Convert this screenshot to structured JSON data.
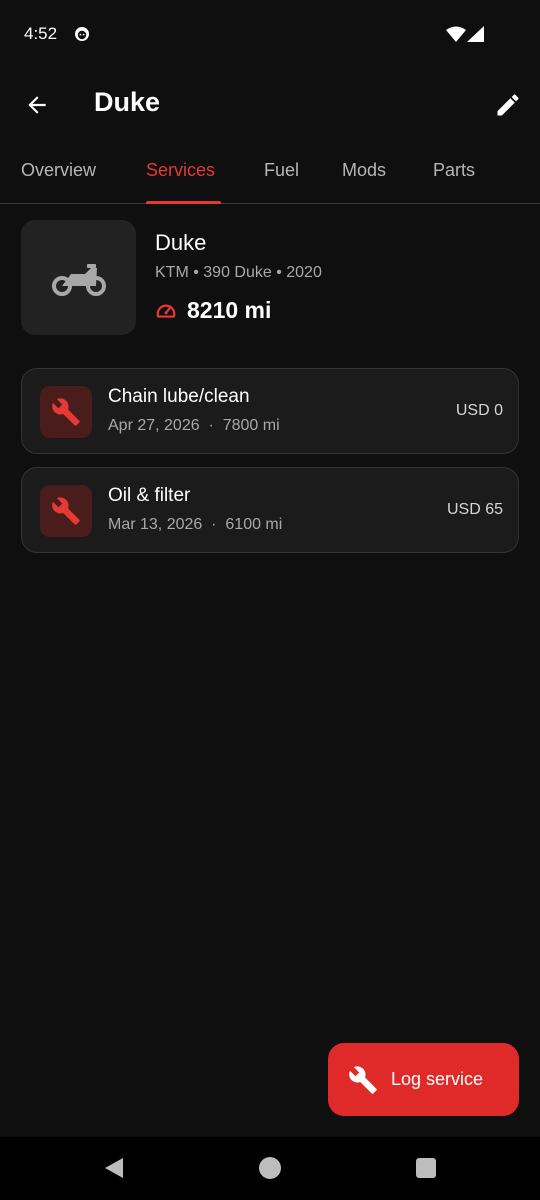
{
  "status_bar": {
    "time": "4:52",
    "icons": [
      "app-notification-icon",
      "wifi-icon",
      "signal-icon"
    ]
  },
  "app_bar": {
    "title": "Duke",
    "back_icon": "arrow-left-icon",
    "edit_icon": "pencil-icon"
  },
  "tabs": [
    {
      "label": "Overview",
      "active": false
    },
    {
      "label": "Services",
      "active": true
    },
    {
      "label": "Fuel",
      "active": false
    },
    {
      "label": "Mods",
      "active": false
    },
    {
      "label": "Parts",
      "active": false
    }
  ],
  "vehicle": {
    "icon": "motorcycle-icon",
    "name": "Duke",
    "subtitle": "KTM • 390 Duke • 2020",
    "odometer_icon": "speedometer-icon",
    "odometer": "8210 mi"
  },
  "services": [
    {
      "icon": "wrench-icon",
      "name": "Chain lube/clean",
      "meta": "Apr 27, 2026  ·  7800 mi",
      "cost": "USD 0"
    },
    {
      "icon": "wrench-icon",
      "name": "Oil & filter",
      "meta": "Mar 13, 2026  ·  6100 mi",
      "cost": "USD 65"
    }
  ],
  "fab": {
    "icon": "wrench-icon",
    "label": "Log service"
  },
  "nav_bar": {
    "icons": [
      "nav-back-icon",
      "nav-home-icon",
      "nav-recents-icon"
    ]
  },
  "colors": {
    "background": "#0f0f0f",
    "accent": "#e53935",
    "card": "#1b1b1b",
    "fab": "#e02a2a"
  }
}
